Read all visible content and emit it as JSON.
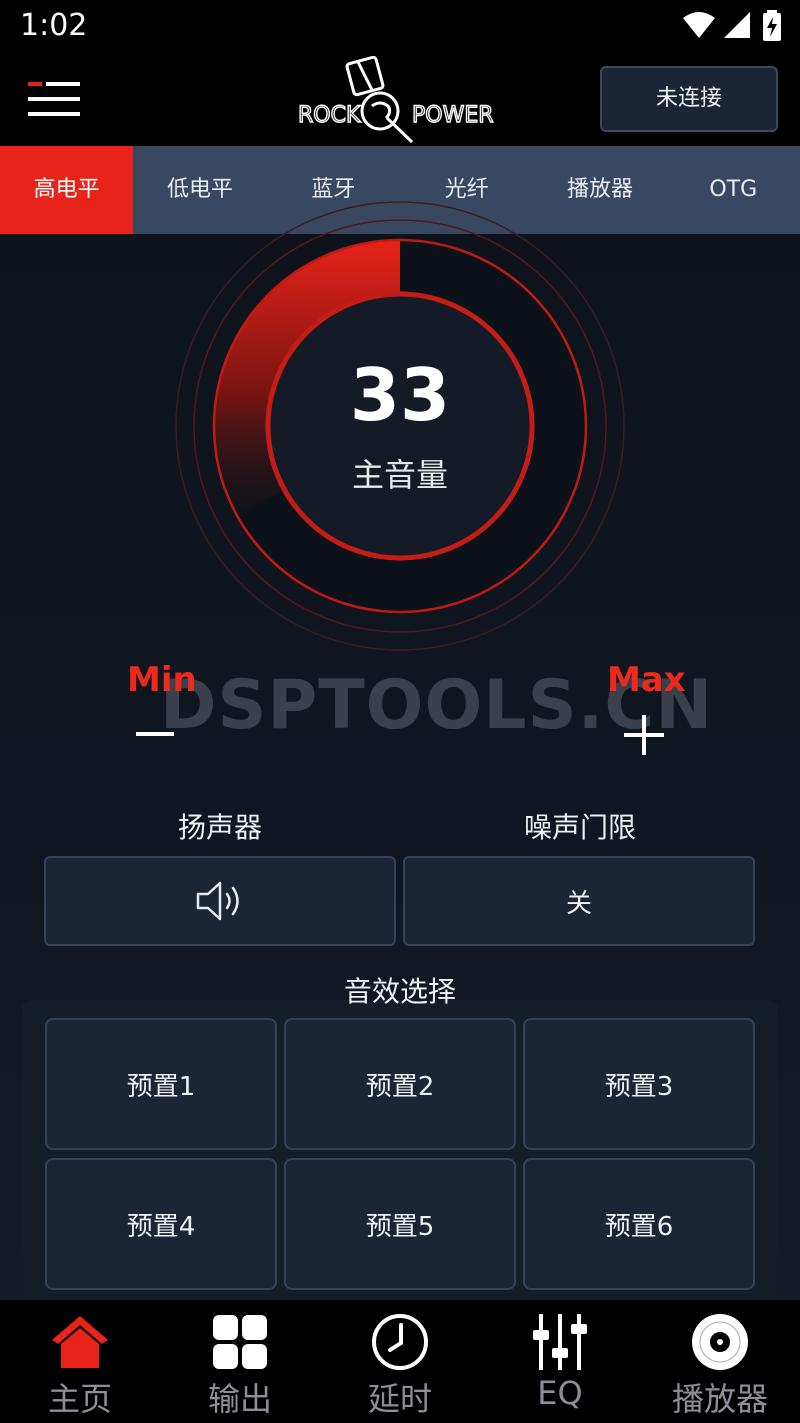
{
  "status_bar": {
    "time": "1:02",
    "icons": [
      "wifi-icon",
      "signal-icon",
      "battery-charging-icon"
    ]
  },
  "header": {
    "menu_icon": "menu-icon",
    "logo_text_left": "ROCK",
    "logo_text_right": "POWER",
    "connect_label": "未连接"
  },
  "tabs": [
    {
      "label": "高电平",
      "active": true
    },
    {
      "label": "低电平",
      "active": false
    },
    {
      "label": "蓝牙",
      "active": false
    },
    {
      "label": "光纤",
      "active": false
    },
    {
      "label": "播放器",
      "active": false
    },
    {
      "label": "OTG",
      "active": false
    }
  ],
  "volume": {
    "value": "33",
    "label": "主音量",
    "min_label": "Min",
    "max_label": "Max",
    "level_fraction": 0.33
  },
  "watermark": "DSPTOOLS.CN",
  "speaker": {
    "title": "扬声器",
    "icon": "speaker-icon"
  },
  "noise_gate": {
    "title": "噪声门限",
    "value": "关"
  },
  "presets": {
    "title": "音效选择",
    "items": [
      "预置1",
      "预置2",
      "预置3",
      "预置4",
      "预置5",
      "预置6"
    ]
  },
  "bottom_nav": [
    {
      "label": "主页",
      "icon": "home-icon",
      "active": true
    },
    {
      "label": "输出",
      "icon": "grid-icon",
      "active": false
    },
    {
      "label": "延时",
      "icon": "clock-icon",
      "active": false
    },
    {
      "label": "EQ",
      "icon": "eq-sliders-icon",
      "active": false
    },
    {
      "label": "播放器",
      "icon": "disc-icon",
      "active": false
    }
  ],
  "colors": {
    "accent": "#e8231a",
    "tab_bar": "#394861",
    "background": "#0e131b",
    "card": "#1b2536"
  }
}
